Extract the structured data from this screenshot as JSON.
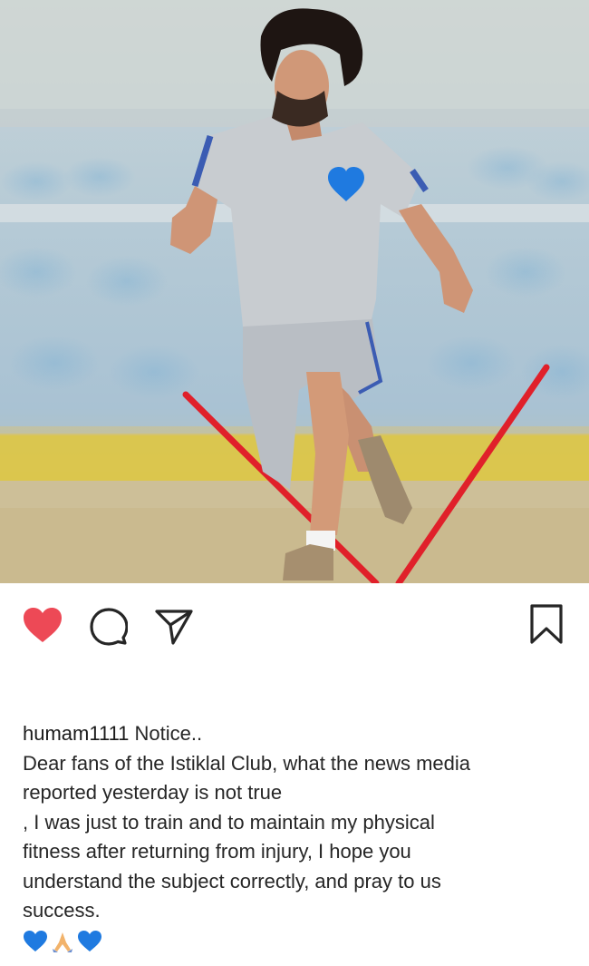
{
  "post": {
    "photo_alt": "football-player-training-photo",
    "liked": true
  },
  "actions": {
    "like_icon": "heart-filled-icon",
    "comment_icon": "comment-bubble-icon",
    "share_icon": "paper-plane-icon",
    "save_icon": "bookmark-icon"
  },
  "caption": {
    "username": "humam1111",
    "lines": [
      " Notice..",
      "Dear fans of the Istiklal Club, what the news media",
      "reported yesterday is not true",
      ", I was just to train and to maintain my physical",
      "fitness after returning from injury, I hope you",
      "understand the subject correctly, and pray to us",
      "success."
    ],
    "emojis": [
      "blue-heart",
      "praying-hands",
      "blue-heart"
    ]
  },
  "colors": {
    "like_red": "#ed4956",
    "text": "#262626",
    "blue_heart": "#1f7ae0",
    "pole_red": "#e0202a"
  }
}
